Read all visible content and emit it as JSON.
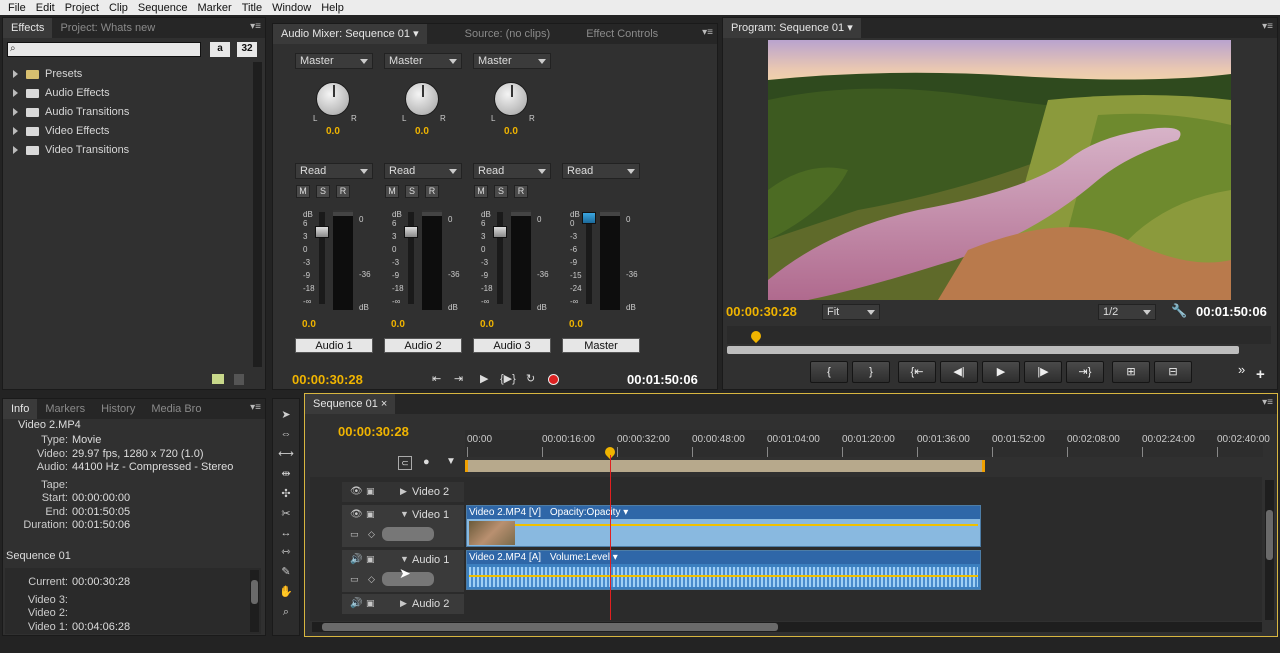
{
  "menu": [
    "File",
    "Edit",
    "Project",
    "Clip",
    "Sequence",
    "Marker",
    "Title",
    "Window",
    "Help"
  ],
  "effects_panel": {
    "tabs": [
      "Effects",
      "Project: Whats new"
    ],
    "search_placeholder": "",
    "btn_a": "a",
    "btn_32": "32",
    "items": [
      "Presets",
      "Audio Effects",
      "Audio Transitions",
      "Video Effects",
      "Video Transitions"
    ]
  },
  "mixer": {
    "tabs": [
      "Audio Mixer: Sequence 01",
      "Source: (no clips)",
      "Effect Controls"
    ],
    "strips": [
      {
        "output": "Master",
        "pan": "0.0",
        "mode": "Read",
        "level": "0.0",
        "label": "Audio 1"
      },
      {
        "output": "Master",
        "pan": "0.0",
        "mode": "Read",
        "level": "0.0",
        "label": "Audio 2"
      },
      {
        "output": "Master",
        "pan": "0.0",
        "mode": "Read",
        "level": "0.0",
        "label": "Audio 3"
      },
      {
        "output": "",
        "pan": "",
        "mode": "Read",
        "level": "0.0",
        "label": "Master"
      }
    ],
    "msr": [
      "M",
      "S",
      "R"
    ],
    "knob_l": "L",
    "knob_r": "R",
    "db": "dB",
    "scale_fader": [
      "6",
      "3",
      "0",
      "-3",
      "-9",
      "-18",
      "-∞"
    ],
    "scale_master": [
      "0",
      "-3",
      "-6",
      "-9",
      "-15",
      "-24",
      "-∞"
    ],
    "meter_ticks": [
      "0",
      "-36",
      "dB"
    ],
    "current_time": "00:00:30:28",
    "duration": "00:01:50:06"
  },
  "program": {
    "tab": "Program: Sequence 01",
    "current_time": "00:00:30:28",
    "fit": "Fit",
    "resolution": "1/2",
    "duration": "00:01:50:06"
  },
  "info_panel": {
    "tabs": [
      "Info",
      "Markers",
      "History",
      "Media Bro"
    ],
    "clip_name": "Video 2.MP4",
    "rows": [
      {
        "k": "Type:",
        "v": "Movie"
      },
      {
        "k": "Video:",
        "v": "29.97 fps, 1280 x 720 (1.0)"
      },
      {
        "k": "Audio:",
        "v": "44100 Hz - Compressed - Stereo"
      },
      {
        "k": "Tape:",
        "v": ""
      },
      {
        "k": "Start:",
        "v": "00:00:00:00"
      },
      {
        "k": "End:",
        "v": "00:01:50:05"
      },
      {
        "k": "Duration:",
        "v": "00:01:50:06"
      }
    ],
    "sequence": "Sequence 01",
    "seq_rows": [
      {
        "k": "Current:",
        "v": "00:00:30:28"
      },
      {
        "k": "Video 3:",
        "v": ""
      },
      {
        "k": "Video 2:",
        "v": ""
      },
      {
        "k": "Video 1:",
        "v": "00:04:06:28"
      }
    ]
  },
  "timeline": {
    "tab": "Sequence 01",
    "current_time": "00:00:30:28",
    "ruler": [
      "00:00",
      "00:00:16:00",
      "00:00:32:00",
      "00:00:48:00",
      "00:01:04:00",
      "00:01:20:00",
      "00:01:36:00",
      "00:01:52:00",
      "00:02:08:00",
      "00:02:24:00",
      "00:02:40:00"
    ],
    "tracks": {
      "video2": "Video 2",
      "video1": "Video 1",
      "audio1": "Audio 1",
      "audio2": "Audio 2"
    },
    "video_clip": {
      "name": "Video 2.MP4 [V]",
      "fx": "Opacity:Opacity"
    },
    "audio_clip": {
      "name": "Video 2.MP4 [A]",
      "fx": "Volume:Level"
    }
  },
  "colors": {
    "accent_timecode": "#f0b400",
    "playhead": "#e02020",
    "clip_blue": "#2f67a8"
  }
}
